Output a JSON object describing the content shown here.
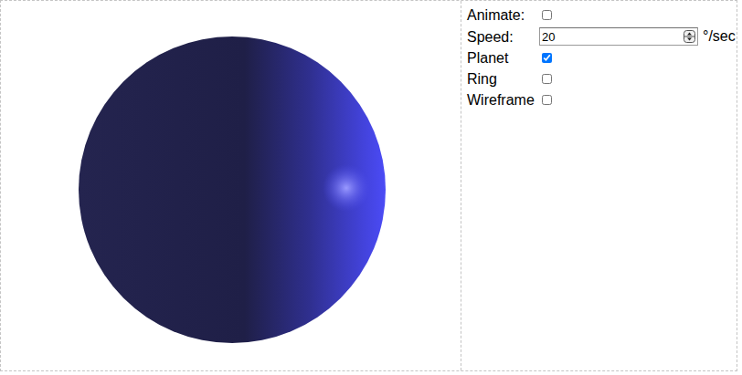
{
  "viewer": {
    "planet_visible": true,
    "ring_visible": false,
    "wireframe": false
  },
  "controls": [
    {
      "kind": "checkbox",
      "label": "Animate:",
      "checked": false
    },
    {
      "kind": "number",
      "label": "Speed:",
      "value": "20",
      "unit": "°/sec"
    },
    {
      "kind": "checkbox",
      "label": "Planet",
      "checked": true
    },
    {
      "kind": "checkbox",
      "label": "Ring",
      "checked": false
    },
    {
      "kind": "checkbox",
      "label": "Wireframe",
      "checked": false
    }
  ]
}
